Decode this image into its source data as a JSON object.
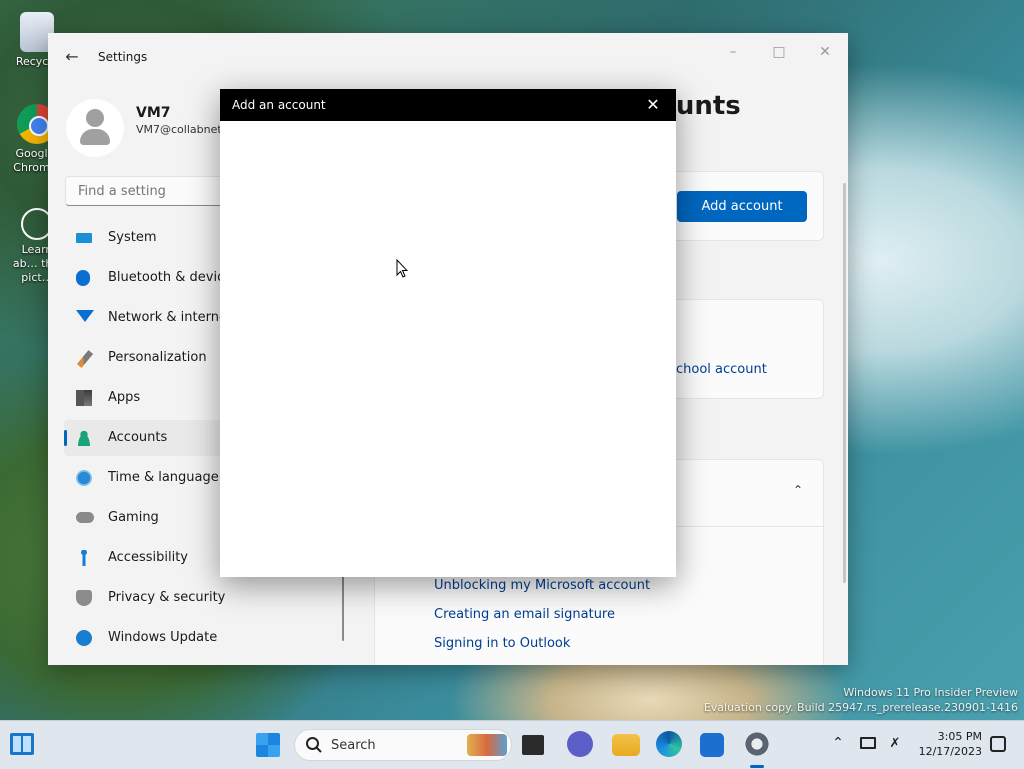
{
  "desktop": {
    "icons": [
      {
        "label": "Recycle",
        "name": "recycle-bin-icon"
      },
      {
        "label": "Googl… Chrom…",
        "name": "chrome-icon"
      },
      {
        "label": "Learn ab… this pict…",
        "name": "learn-about-picture-icon"
      }
    ],
    "watermark_line1": "Windows 11 Pro Insider Preview",
    "watermark_line2": "Evaluation copy. Build 25947.rs_prerelease.230901-1416"
  },
  "settings": {
    "window_title": "Settings",
    "profile": {
      "name": "VM7",
      "email": "VM7@collabnet"
    },
    "search_placeholder": "Find a setting",
    "nav": [
      {
        "label": "System",
        "icon": "system-icon"
      },
      {
        "label": "Bluetooth & devic",
        "icon": "bluetooth-icon"
      },
      {
        "label": "Network & interne",
        "icon": "wifi-icon"
      },
      {
        "label": "Personalization",
        "icon": "brush-icon"
      },
      {
        "label": "Apps",
        "icon": "apps-icon"
      },
      {
        "label": "Accounts",
        "icon": "accounts-icon",
        "selected": true
      },
      {
        "label": "Time & language",
        "icon": "time-language-icon"
      },
      {
        "label": "Gaming",
        "icon": "gamepad-icon"
      },
      {
        "label": "Accessibility",
        "icon": "accessibility-icon"
      },
      {
        "label": "Privacy & security",
        "icon": "shield-icon"
      },
      {
        "label": "Windows Update",
        "icon": "update-icon"
      }
    ],
    "page_title": "ounts",
    "add_account_button": "Add account",
    "school_account_link": "chool account",
    "related_links": [
      "Unblocking my Microsoft account",
      "Creating an email signature",
      "Signing in to Outlook"
    ]
  },
  "dialog": {
    "title": "Add an account"
  },
  "taskbar": {
    "search_label": "Search",
    "time": "3:05 PM",
    "date": "12/17/2023"
  },
  "colors": {
    "accent": "#0067c0",
    "link": "#003e92",
    "dialog_header": "#000000"
  }
}
